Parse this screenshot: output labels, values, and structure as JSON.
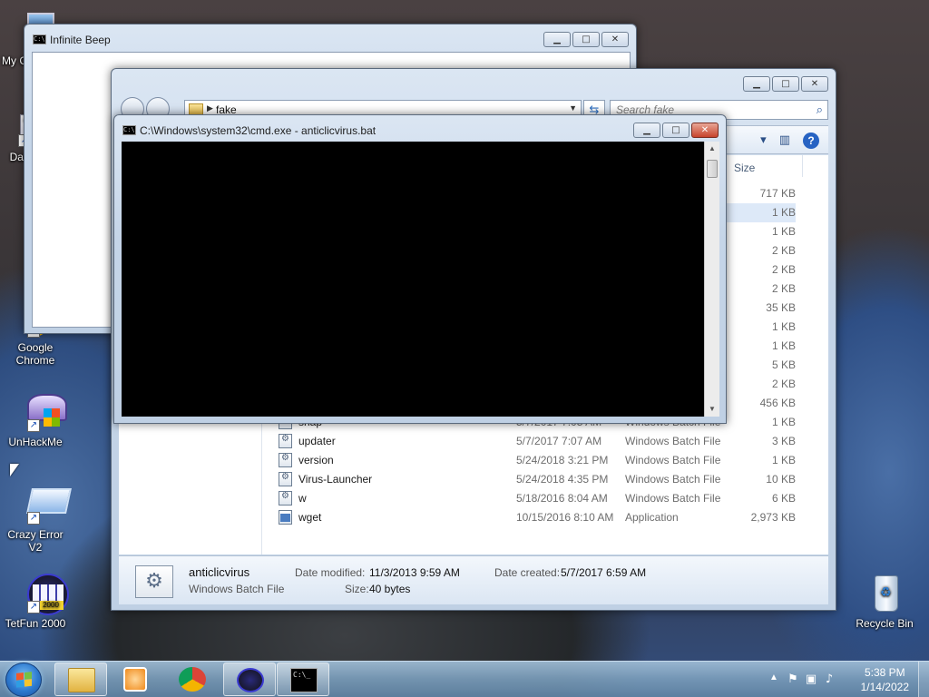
{
  "desktop": {
    "icons": [
      {
        "label": "My C",
        "icon": "computer-icon"
      },
      {
        "label": "Data",
        "icon": "data-icon"
      },
      {
        "label": "Google Chrome",
        "icon": "chrome-icon"
      },
      {
        "label": "UnHackMe",
        "icon": "unhackme-icon"
      },
      {
        "label": "Crazy Error V2",
        "icon": "crazy-error-icon"
      },
      {
        "label": "TetFun 2000",
        "icon": "tetfun-icon"
      },
      {
        "label": "Recycle Bin",
        "icon": "recycle-bin-icon"
      }
    ]
  },
  "beep_window": {
    "title": "Infinite Beep"
  },
  "cmd_window": {
    "title": "C:\\Windows\\system32\\cmd.exe - anticlicvirus.bat"
  },
  "explorer": {
    "address_segments": [
      "fake"
    ],
    "search_placeholder": "Search fake",
    "size_header": "Size",
    "partial_sizes": [
      "717 KB",
      "1 KB",
      "1 KB",
      "2 KB",
      "2 KB",
      "2 KB",
      "35 KB",
      "1 KB",
      "1 KB",
      "5 KB",
      "2 KB",
      "456 KB"
    ],
    "files": [
      {
        "name": "snap",
        "date": "5/7/2017 7:05 AM",
        "type": "Windows Batch File",
        "size": "1 KB"
      },
      {
        "name": "updater",
        "date": "5/7/2017 7:07 AM",
        "type": "Windows Batch File",
        "size": "3 KB"
      },
      {
        "name": "version",
        "date": "5/24/2018 3:21 PM",
        "type": "Windows Batch File",
        "size": "1 KB"
      },
      {
        "name": "Virus-Launcher",
        "date": "5/24/2018 4:35 PM",
        "type": "Windows Batch File",
        "size": "10 KB"
      },
      {
        "name": "w",
        "date": "5/18/2016 8:04 AM",
        "type": "Windows Batch File",
        "size": "6 KB"
      },
      {
        "name": "wget",
        "date": "10/15/2016 8:10 AM",
        "type": "Application",
        "size": "2,973 KB"
      }
    ],
    "details": {
      "name": "anticlicvirus",
      "type": "Windows Batch File",
      "modified_label": "Date modified:",
      "modified_value": "11/3/2013 9:59 AM",
      "created_label": "Date created:",
      "created_value": "5/7/2017 6:59 AM",
      "size_label": "Size:",
      "size_value": "40 bytes"
    }
  },
  "taskbar": {
    "items": [
      "explorer-icon",
      "media-player-icon",
      "chrome-icon",
      "tetfun-icon",
      "cmd-icon"
    ],
    "clock_time": "5:38 PM",
    "clock_date": "1/14/2022"
  }
}
